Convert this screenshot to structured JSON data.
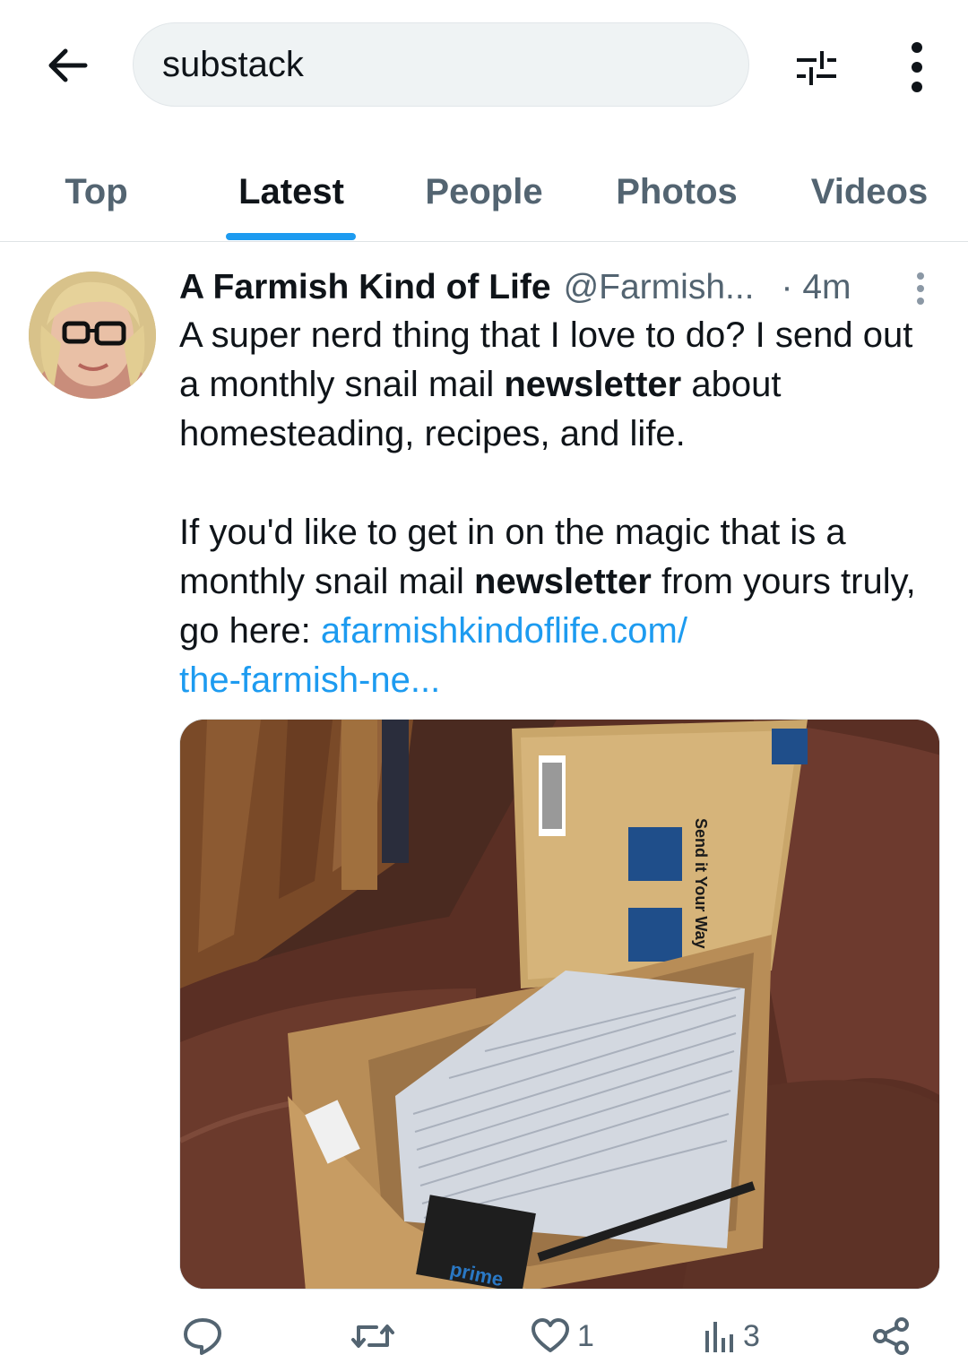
{
  "search": {
    "query": "substack"
  },
  "tabs": [
    {
      "label": "Top",
      "active": false
    },
    {
      "label": "Latest",
      "active": true
    },
    {
      "label": "People",
      "active": false
    },
    {
      "label": "Photos",
      "active": false
    },
    {
      "label": "Videos",
      "active": false
    }
  ],
  "tweet": {
    "author_name": "A Farmish Kind of Life",
    "author_handle": "@Farmish...",
    "time": "· 4m",
    "p1_a": "A super nerd thing that I love to do? I send out a monthly snail mail ",
    "p1_bold": "newsletter",
    "p1_b": " about homesteading, recipes, and life.",
    "p2_a": "If you'd like to get in on the magic that is a monthly snail mail ",
    "p2_bold": "newsletter",
    "p2_b": " from yours truly, go here: ",
    "link_line1": "afarmishkindoflife.com/",
    "link_line2": "the-farmish-ne...",
    "image_label_send": "Send it Your Way",
    "image_label_prime": "prime",
    "actions": {
      "reply_count": "",
      "retweet_count": "",
      "like_count": "1",
      "views_count": "3"
    }
  },
  "icons": {
    "back": "arrow-left-icon",
    "filter": "filter-sliders-icon",
    "more": "more-vertical-icon",
    "tweet_menu": "more-vertical-icon",
    "reply": "reply-bubble-icon",
    "retweet": "retweet-icon",
    "like": "heart-icon",
    "views": "views-bar-icon",
    "share": "share-nodes-icon"
  },
  "colors": {
    "accent": "#1d9bf0",
    "text_primary": "#0f1419",
    "text_secondary": "#536471",
    "search_bg": "#eff3f4"
  }
}
